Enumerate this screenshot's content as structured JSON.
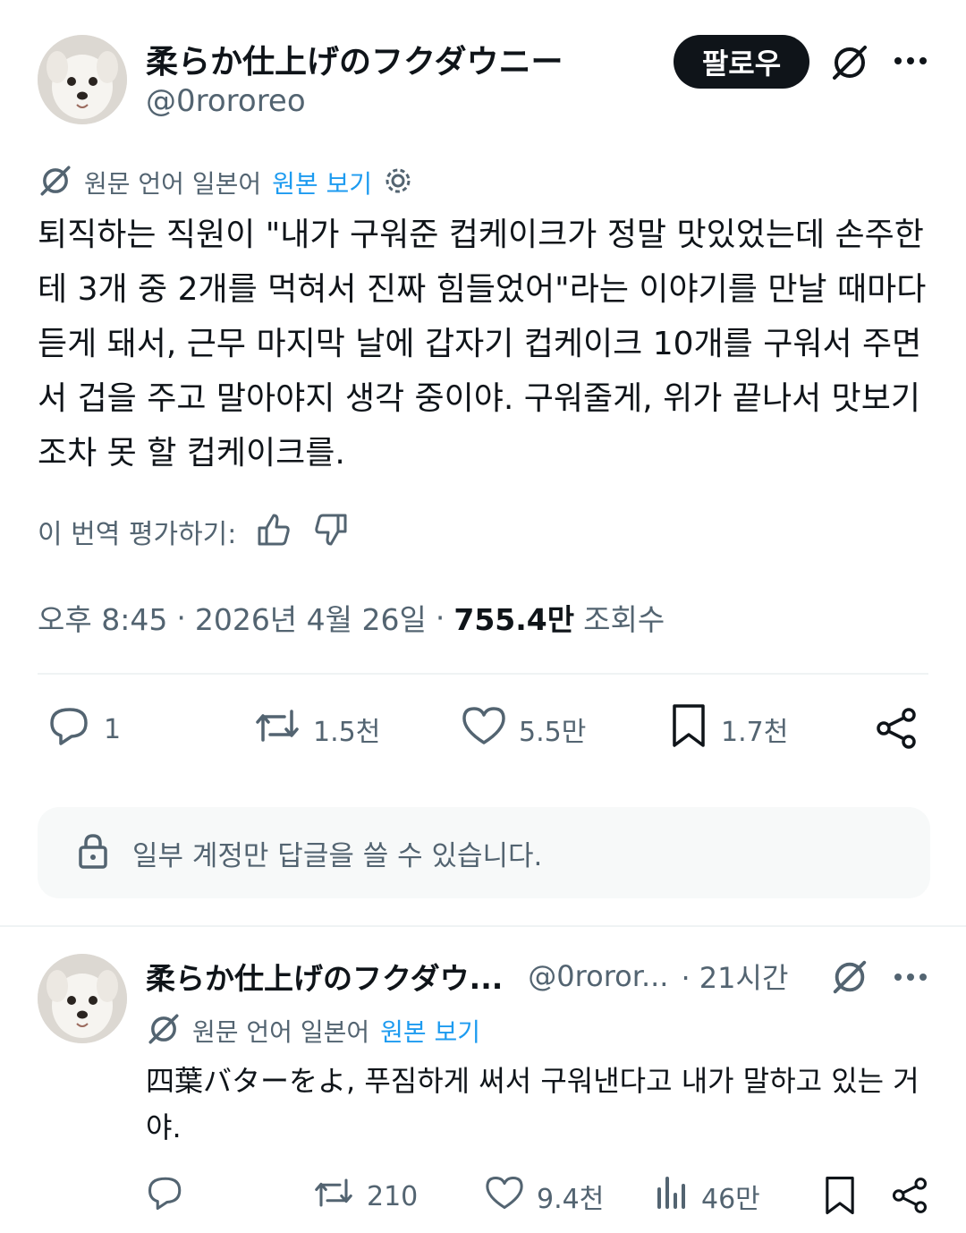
{
  "main_tweet": {
    "author_name": "柔らか仕上げのフクダウニー",
    "author_handle": "@0rororeo",
    "follow_label": "팔로우",
    "translation": {
      "source_label": "원문 언어 일본어",
      "show_original_label": "원본 보기"
    },
    "text": "퇴직하는 직원이 \"내가 구워준 컵케이크가 정말 맛있었는데 손주한테 3개 중 2개를 먹혀서 진짜 힘들었어\"라는 이야기를 만날 때마다 듣게 돼서, 근무 마지막 날에 갑자기 컵케이크 10개를 구워서 주면서 겁을 주고 말아야지 생각 중이야. 구워줄게, 위가 끝나서 맛보기조차 못 할 컵케이크를.",
    "rate_label": "이 번역 평가하기:",
    "time": "오후 8:45",
    "date": "2026년 4월 26일",
    "views": "755.4만",
    "views_label": "조회수",
    "actions": {
      "replies": "1",
      "reposts": "1.5천",
      "likes": "5.5만",
      "bookmarks": "1.7천"
    },
    "reply_notice": "일부 계정만 답글을 쓸 수 있습니다."
  },
  "reply_tweet": {
    "author_name": "柔らか仕上げのフクダウ...",
    "author_handle": "@0roror...",
    "time_ago": "· 21시간",
    "translation": {
      "source_label": "원문 언어 일본어",
      "show_original_label": "원본 보기"
    },
    "text": "四葉バターをよ, 푸짐하게 써서 구워낸다고 내가 말하고 있는 거야.",
    "actions": {
      "replies": "",
      "reposts": "210",
      "likes": "9.4천",
      "views": "46만"
    }
  },
  "icons": [
    "translate-icon",
    "more-icon",
    "settings-icon",
    "thumbs-up-icon",
    "thumbs-down-icon",
    "reply-icon",
    "repost-icon",
    "like-icon",
    "bookmark-icon",
    "share-icon",
    "lock-icon",
    "views-icon"
  ],
  "colors": {
    "text": "#0f1419",
    "secondary": "#536471",
    "link": "#1d9bf0",
    "follow_bg": "#0f1419"
  }
}
